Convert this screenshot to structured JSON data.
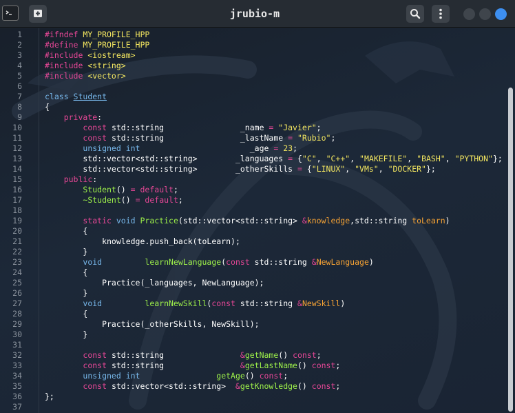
{
  "window": {
    "title": "jrubio-m",
    "colors": {
      "accent": "#3d8ff0",
      "header": "#262c33",
      "editor_bg": "#1c2531"
    }
  },
  "header": {
    "icons": [
      "terminal-icon",
      "new-tab-icon",
      "search-icon",
      "kebab-menu-icon"
    ],
    "window_controls": [
      "minimize",
      "maximize",
      "close"
    ]
  },
  "editor": {
    "line_numbers": [
      "1",
      "2",
      "3",
      "4",
      "5",
      "6",
      "7",
      "8",
      "9",
      "10",
      "11",
      "12",
      "13",
      "14",
      "15",
      "16",
      "17",
      "18",
      "19",
      "20",
      "21",
      "22",
      "23",
      "24",
      "25",
      "26",
      "27",
      "28",
      "29",
      "30",
      "31",
      "32",
      "33",
      "34",
      "35",
      "36",
      "37"
    ],
    "syntax_colors": {
      "preprocessor": "#e64796",
      "macro": "#f4e760",
      "keyword": "#e64796",
      "type": "#77b7ea",
      "string": "#f4e760",
      "function": "#9ef14a",
      "parameter": "#f7a334"
    },
    "lines": [
      [
        [
          "pp",
          "#ifndef "
        ],
        [
          "macro",
          "MY_PROFILE_HPP"
        ]
      ],
      [
        [
          "pp",
          "#define "
        ],
        [
          "macro",
          "MY_PROFILE_HPP"
        ]
      ],
      [
        [
          "pp",
          "#include "
        ],
        [
          "str",
          "<iostream>"
        ]
      ],
      [
        [
          "pp",
          "#include "
        ],
        [
          "str",
          "<string>"
        ]
      ],
      [
        [
          "pp",
          "#include "
        ],
        [
          "str",
          "<vector>"
        ]
      ],
      [],
      [
        [
          "typ",
          "class "
        ],
        [
          "cls",
          "Student"
        ]
      ],
      [
        [
          "",
          "{"
        ]
      ],
      [
        [
          "",
          "    "
        ],
        [
          "kw",
          "private"
        ],
        [
          "",
          ":"
        ]
      ],
      [
        [
          "",
          "        "
        ],
        [
          "kw",
          "const "
        ],
        [
          "",
          "std::string                "
        ],
        [
          "",
          "_name "
        ],
        [
          "op",
          "= "
        ],
        [
          "str",
          "\"Javier\""
        ],
        [
          "",
          ";"
        ]
      ],
      [
        [
          "",
          "        "
        ],
        [
          "kw",
          "const "
        ],
        [
          "",
          "std::string                "
        ],
        [
          "",
          "_lastName "
        ],
        [
          "op",
          "= "
        ],
        [
          "str",
          "\"Rubio\""
        ],
        [
          "",
          ";"
        ]
      ],
      [
        [
          "",
          "        "
        ],
        [
          "typ",
          "unsigned int"
        ],
        [
          "",
          "                       "
        ],
        [
          "",
          "_age "
        ],
        [
          "op",
          "= "
        ],
        [
          "num",
          "23"
        ],
        [
          "",
          ";"
        ]
      ],
      [
        [
          "",
          "        "
        ],
        [
          "",
          "std::vector<std::string>        "
        ],
        [
          "",
          "_languages "
        ],
        [
          "op",
          "= "
        ],
        [
          "",
          "{"
        ],
        [
          "str",
          "\"C\""
        ],
        [
          "",
          ", "
        ],
        [
          "str",
          "\"C++\""
        ],
        [
          "",
          ", "
        ],
        [
          "str",
          "\"MAKEFILE\""
        ],
        [
          "",
          ", "
        ],
        [
          "str",
          "\"BASH\""
        ],
        [
          "",
          ", "
        ],
        [
          "str",
          "\"PYTHON\""
        ],
        [
          "",
          "};"
        ]
      ],
      [
        [
          "",
          "        "
        ],
        [
          "",
          "std::vector<std::string>        "
        ],
        [
          "",
          "_otherSkills "
        ],
        [
          "op",
          "= "
        ],
        [
          "",
          "{"
        ],
        [
          "str",
          "\"LINUX\""
        ],
        [
          "",
          ", "
        ],
        [
          "str",
          "\"VMs\""
        ],
        [
          "",
          ", "
        ],
        [
          "str",
          "\"DOCKER\""
        ],
        [
          "",
          "};"
        ]
      ],
      [
        [
          "",
          "    "
        ],
        [
          "kw",
          "public"
        ],
        [
          "",
          ":"
        ]
      ],
      [
        [
          "",
          "        "
        ],
        [
          "fn",
          "Student"
        ],
        [
          "",
          "() "
        ],
        [
          "op",
          "= "
        ],
        [
          "kw",
          "default"
        ],
        [
          "",
          ";"
        ]
      ],
      [
        [
          "",
          "        "
        ],
        [
          "fn",
          "~Student"
        ],
        [
          "",
          "() "
        ],
        [
          "op",
          "= "
        ],
        [
          "kw",
          "default"
        ],
        [
          "",
          ";"
        ]
      ],
      [],
      [
        [
          "",
          "        "
        ],
        [
          "kw",
          "static "
        ],
        [
          "typ",
          "void "
        ],
        [
          "fn",
          "Practice"
        ],
        [
          "",
          "(std::vector<std::string> "
        ],
        [
          "op",
          "&"
        ],
        [
          "par",
          "knowledge"
        ],
        [
          "",
          ",std::string "
        ],
        [
          "par",
          "toLearn"
        ],
        [
          "",
          ")"
        ]
      ],
      [
        [
          "",
          "        {"
        ]
      ],
      [
        [
          "",
          "            knowledge.push_back(toLearn);"
        ]
      ],
      [
        [
          "",
          "        }"
        ]
      ],
      [
        [
          "",
          "        "
        ],
        [
          "typ",
          "void"
        ],
        [
          "",
          "         "
        ],
        [
          "fn",
          "learnNewLanguage"
        ],
        [
          "",
          "("
        ],
        [
          "kw",
          "const "
        ],
        [
          "",
          "std::string "
        ],
        [
          "op",
          "&"
        ],
        [
          "par",
          "NewLanguage"
        ],
        [
          "",
          ")"
        ]
      ],
      [
        [
          "",
          "        {"
        ]
      ],
      [
        [
          "",
          "            Practice(_languages, NewLanguage);"
        ]
      ],
      [
        [
          "",
          "        }"
        ]
      ],
      [
        [
          "",
          "        "
        ],
        [
          "typ",
          "void"
        ],
        [
          "",
          "         "
        ],
        [
          "fn",
          "learnNewSkill"
        ],
        [
          "",
          "("
        ],
        [
          "kw",
          "const "
        ],
        [
          "",
          "std::string "
        ],
        [
          "op",
          "&"
        ],
        [
          "par",
          "NewSkill"
        ],
        [
          "",
          ")"
        ]
      ],
      [
        [
          "",
          "        {"
        ]
      ],
      [
        [
          "",
          "            Practice(_otherSkills, NewSkill);"
        ]
      ],
      [
        [
          "",
          "        }"
        ]
      ],
      [],
      [
        [
          "",
          "        "
        ],
        [
          "kw",
          "const "
        ],
        [
          "",
          "std::string                "
        ],
        [
          "op",
          "&"
        ],
        [
          "fn",
          "getName"
        ],
        [
          "",
          "() "
        ],
        [
          "kw",
          "const"
        ],
        [
          "",
          ";"
        ]
      ],
      [
        [
          "",
          "        "
        ],
        [
          "kw",
          "const "
        ],
        [
          "",
          "std::string                "
        ],
        [
          "op",
          "&"
        ],
        [
          "fn",
          "getLastName"
        ],
        [
          "",
          "() "
        ],
        [
          "kw",
          "const"
        ],
        [
          "",
          ";"
        ]
      ],
      [
        [
          "",
          "        "
        ],
        [
          "typ",
          "unsigned int"
        ],
        [
          "",
          "                "
        ],
        [
          "fn",
          "getAge"
        ],
        [
          "",
          "() "
        ],
        [
          "kw",
          "const"
        ],
        [
          "",
          ";"
        ]
      ],
      [
        [
          "",
          "        "
        ],
        [
          "kw",
          "const "
        ],
        [
          "",
          "std::vector<std::string>  "
        ],
        [
          "op",
          "&"
        ],
        [
          "fn",
          "getKnowledge"
        ],
        [
          "",
          "() "
        ],
        [
          "kw",
          "const"
        ],
        [
          "",
          ";"
        ]
      ],
      [
        [
          "",
          "};"
        ]
      ],
      []
    ]
  }
}
